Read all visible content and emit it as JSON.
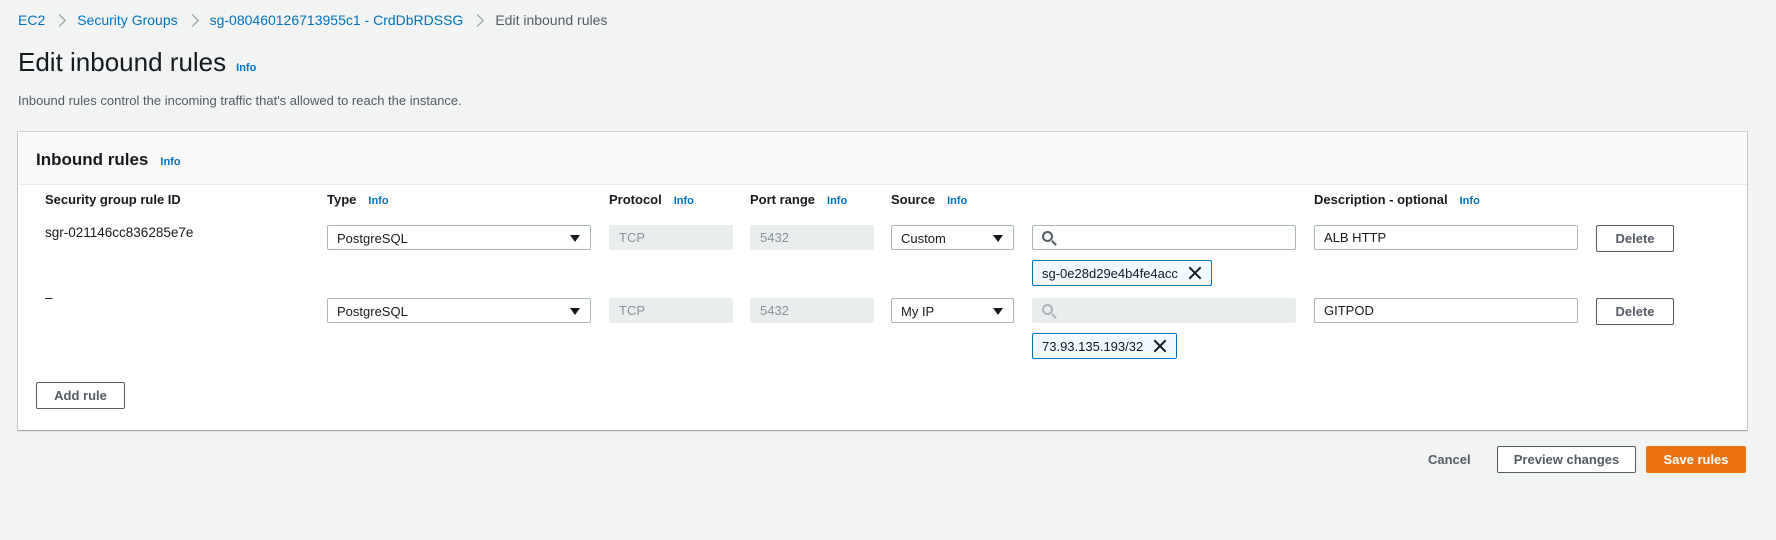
{
  "breadcrumb": {
    "items": [
      "EC2",
      "Security Groups",
      "sg-080460126713955c1 - CrdDbRDSSG"
    ],
    "current": "Edit inbound rules"
  },
  "page": {
    "title": "Edit inbound rules",
    "title_info": "Info",
    "description": "Inbound rules control the incoming traffic that's allowed to reach the instance."
  },
  "panel": {
    "title": "Inbound rules",
    "info": "Info",
    "columns": {
      "rule_id": "Security group rule ID",
      "type": "Type",
      "protocol": "Protocol",
      "port_range": "Port range",
      "source": "Source",
      "description": "Description - optional",
      "info": "Info"
    },
    "rules": [
      {
        "rule_id": "sgr-021146cc836285e7e",
        "type": "PostgreSQL",
        "protocol": "TCP",
        "port_range": "5432",
        "source": "Custom",
        "search_value": "",
        "token": "sg-0e28d29e4b4fe4acc",
        "description": "ALB HTTP",
        "delete_label": "Delete"
      },
      {
        "rule_id": "–",
        "type": "PostgreSQL",
        "protocol": "TCP",
        "port_range": "5432",
        "source": "My IP",
        "search_value": "",
        "token": "73.93.135.193/32",
        "description": "GITPOD",
        "delete_label": "Delete"
      }
    ],
    "add_rule_label": "Add rule"
  },
  "footer": {
    "cancel_label": "Cancel",
    "preview_label": "Preview changes",
    "save_label": "Save rules"
  },
  "colors": {
    "link": "#0073bb",
    "primary": "#ec7211",
    "background": "#f2f3f3"
  }
}
